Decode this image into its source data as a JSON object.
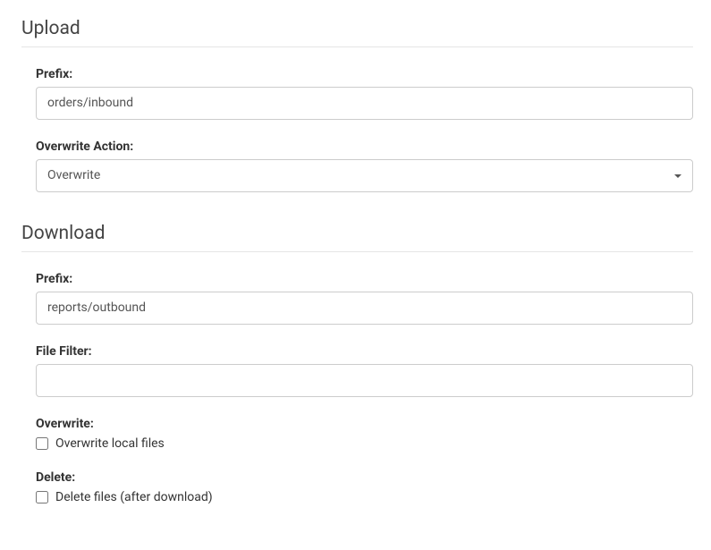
{
  "upload": {
    "heading": "Upload",
    "prefix_label": "Prefix:",
    "prefix_value": "orders/inbound",
    "overwrite_action_label": "Overwrite Action:",
    "overwrite_action_value": "Overwrite"
  },
  "download": {
    "heading": "Download",
    "prefix_label": "Prefix:",
    "prefix_value": "reports/outbound",
    "file_filter_label": "File Filter:",
    "file_filter_value": "",
    "overwrite_label": "Overwrite:",
    "overwrite_checkbox_label": "Overwrite local files",
    "delete_label": "Delete:",
    "delete_checkbox_label": "Delete files (after download)"
  }
}
